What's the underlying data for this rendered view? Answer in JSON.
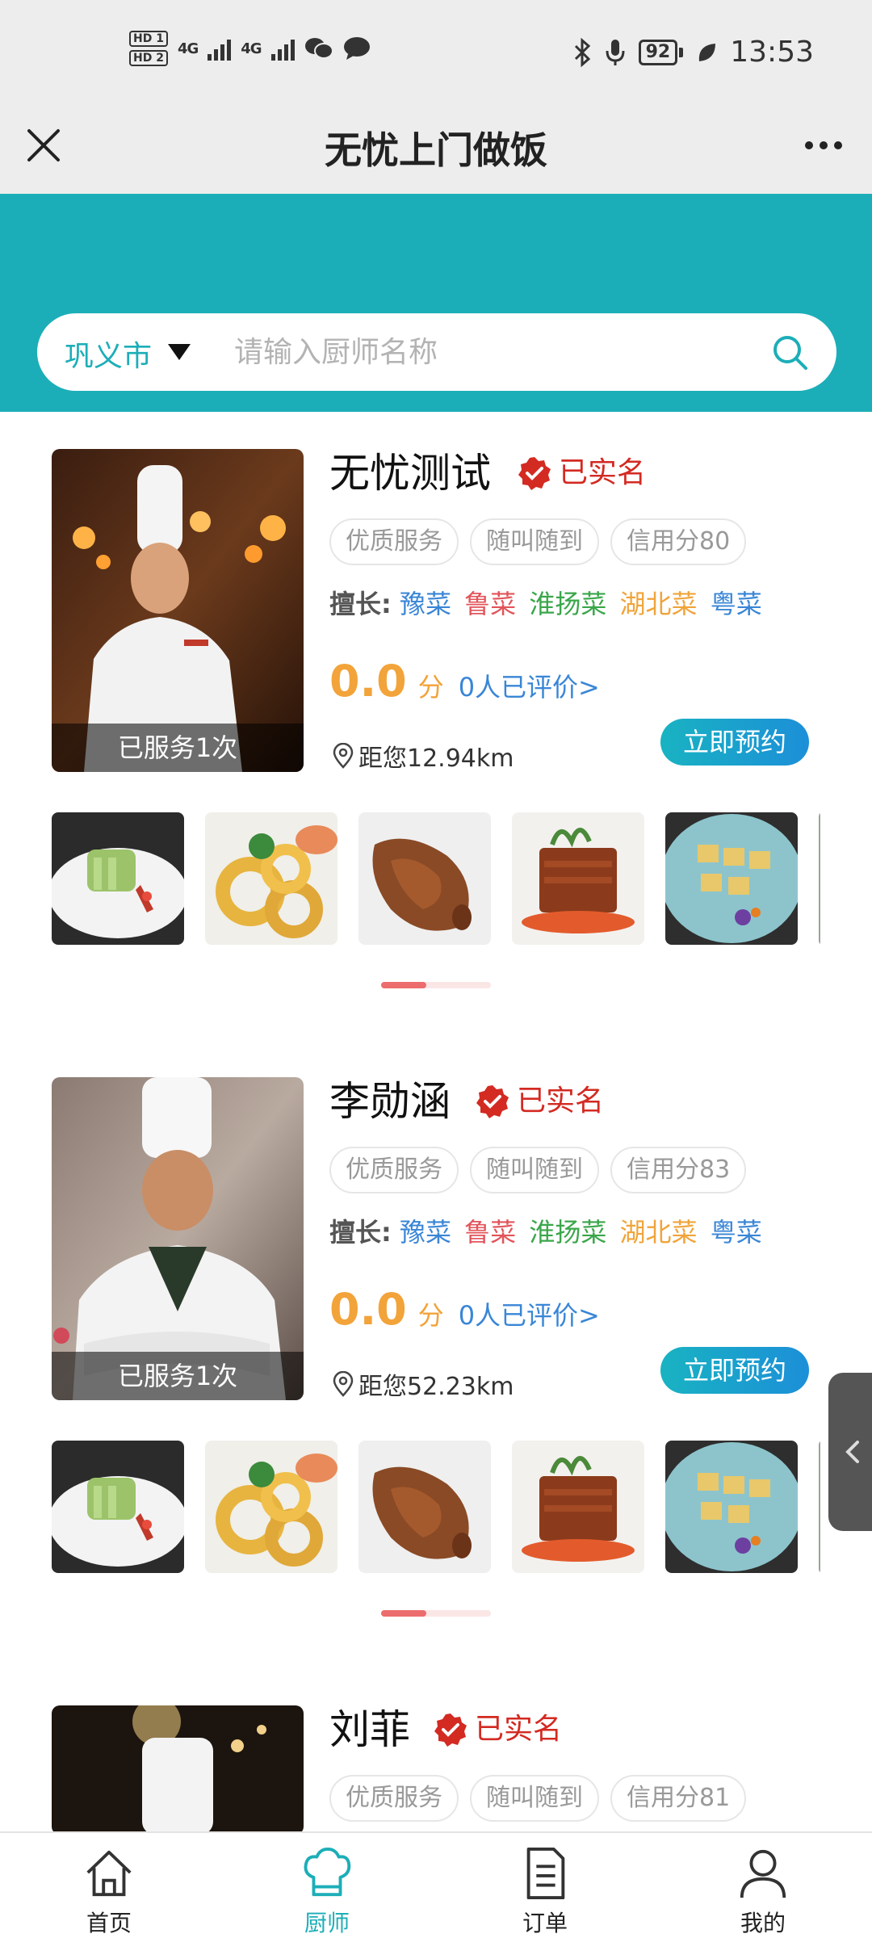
{
  "status_bar": {
    "hd1": "HD 1",
    "hd2": "HD 2",
    "net1": "4G",
    "net2": "4G",
    "battery": "92",
    "time": "13:53"
  },
  "titlebar": {
    "title": "无忧上门做饭"
  },
  "search": {
    "city": "巩义市",
    "placeholder": "请输入厨师名称"
  },
  "chefs": [
    {
      "name": "无忧测试",
      "verified": "已实名",
      "served": "已服务1次",
      "tags": [
        "优质服务",
        "随叫随到",
        "信用分80"
      ],
      "specialty_label": "擅长:",
      "specialties": [
        "豫菜",
        "鲁菜",
        "淮扬菜",
        "湖北菜",
        "粤菜"
      ],
      "score": "0.0",
      "score_unit": "分",
      "reviews": "0人已评价>",
      "distance": "距您12.94km",
      "book": "立即预约"
    },
    {
      "name": "李勋涵",
      "verified": "已实名",
      "served": "已服务1次",
      "tags": [
        "优质服务",
        "随叫随到",
        "信用分83"
      ],
      "specialty_label": "擅长:",
      "specialties": [
        "豫菜",
        "鲁菜",
        "淮扬菜",
        "湖北菜",
        "粤菜"
      ],
      "score": "0.0",
      "score_unit": "分",
      "reviews": "0人已评价>",
      "distance": "距您52.23km",
      "book": "立即预约"
    },
    {
      "name": "刘菲",
      "verified": "已实名",
      "tags": [
        "优质服务",
        "随叫随到",
        "信用分81"
      ]
    }
  ],
  "specialty_colors": [
    "#3a86d6",
    "#e2545a",
    "#3aa64a",
    "#f0a43a",
    "#3a86d6"
  ],
  "accent_color": "#1caeb8",
  "tabs": [
    {
      "label": "首页",
      "icon": "home-icon"
    },
    {
      "label": "厨师",
      "icon": "chef-hat-icon"
    },
    {
      "label": "订单",
      "icon": "document-icon"
    },
    {
      "label": "我的",
      "icon": "person-icon"
    }
  ]
}
